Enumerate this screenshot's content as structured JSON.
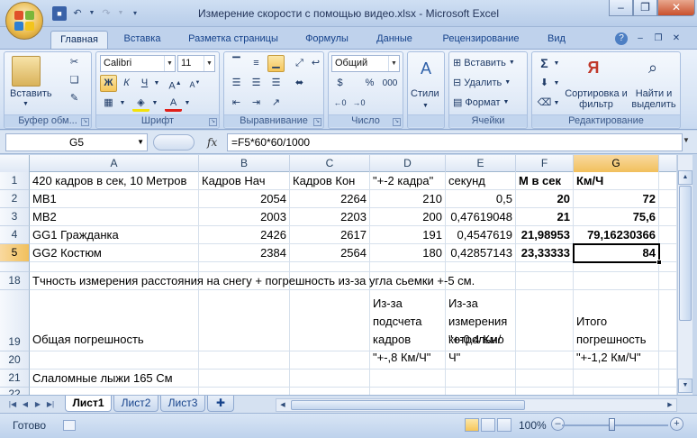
{
  "window": {
    "title": "Измерение скорости с помощью видео.xlsx - Microsoft Excel",
    "minimize": "–",
    "restore": "❐",
    "close": "✕"
  },
  "ribbon_tabs": [
    "Главная",
    "Вставка",
    "Разметка страницы",
    "Формулы",
    "Данные",
    "Рецензирование",
    "Вид"
  ],
  "ribbon": {
    "clipboard": {
      "paste": "Вставить",
      "label": "Буфер обм..."
    },
    "font": {
      "name": "Calibri",
      "size": "11",
      "bold": "Ж",
      "italic": "К",
      "underline": "Ч",
      "label": "Шрифт"
    },
    "alignment": {
      "label": "Выравнивание"
    },
    "number": {
      "format": "Общий",
      "percent": "%",
      "thousands": "000",
      "label": "Число"
    },
    "styles": {
      "button": "Стили"
    },
    "cells": {
      "insert": "Вставить",
      "delete": "Удалить",
      "format": "Формат",
      "label": "Ячейки"
    },
    "editing": {
      "sigma": "Σ",
      "sort": "Сортировка и фильтр",
      "find": "Найти и выделить",
      "label": "Редактирование"
    }
  },
  "formula_bar": {
    "name_box": "G5",
    "fx": "fx",
    "formula": "=F5*60*60/1000"
  },
  "columns": [
    "A",
    "B",
    "C",
    "D",
    "E",
    "F",
    "G"
  ],
  "rows": [
    {
      "num": "1",
      "cells": [
        "420 кадров в сек, 10 Метров",
        "Кадров Нач",
        "Кадров Кон",
        "\"+-2 кадра\"",
        "секунд",
        "М в сек",
        "Км/Ч"
      ]
    },
    {
      "num": "2",
      "cells": [
        "MB1",
        "2054",
        "2264",
        "210",
        "0,5",
        "20",
        "72"
      ]
    },
    {
      "num": "3",
      "cells": [
        "MB2",
        "2003",
        "2203",
        "200",
        "0,47619048",
        "21",
        "75,6"
      ]
    },
    {
      "num": "4",
      "cells": [
        "GG1 Гражданка",
        "2426",
        "2617",
        "191",
        "0,4547619",
        "21,98953",
        "79,16230366"
      ]
    },
    {
      "num": "5",
      "cells": [
        "GG2 Костюм",
        "2384",
        "2564",
        "180",
        "0,42857143",
        "23,33333",
        "84"
      ]
    },
    {
      "num": "17",
      "cells": [
        "",
        "",
        "",
        "",
        "",
        "",
        ""
      ]
    },
    {
      "num": "18",
      "cells": [
        "Тчность измерения расстояния на снегу + погрешность из-за угла сьемки +-5 см.",
        "",
        "",
        "",
        "",
        "",
        ""
      ]
    },
    {
      "num": "19",
      "cells": [
        "Общая погрешность",
        "",
        "",
        "Из-за подсчета кадров",
        "Из-за измерения котрольно",
        "",
        "Итого погрешность"
      ]
    },
    {
      "num": "20",
      "cells": [
        "",
        "",
        "",
        "\"+-,8 Км/Ч\"",
        "\"+-0,4 Км/Ч\"",
        "",
        "\"+-1,2 Км/Ч\""
      ]
    },
    {
      "num": "21",
      "cells": [
        "Слаломные  лыжи 165 См",
        "",
        "",
        "",
        "",
        "",
        ""
      ]
    },
    {
      "num": "22",
      "cells": [
        "",
        "",
        "",
        "",
        "",
        "",
        ""
      ]
    }
  ],
  "sheets": [
    "Лист1",
    "Лист2",
    "Лист3"
  ],
  "status": {
    "ready": "Готово",
    "zoom": "100%",
    "zoom_out": "–",
    "zoom_in": "+"
  }
}
